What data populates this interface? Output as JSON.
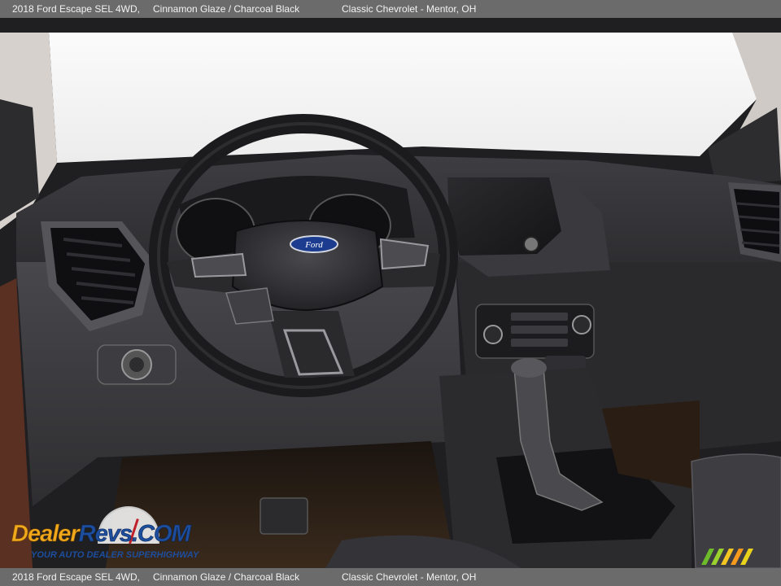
{
  "caption": {
    "vehicle": "2018 Ford Escape SEL 4WD,",
    "colors": "Cinnamon Glaze / Charcoal Black",
    "dealer": "Classic Chevrolet - Mentor, OH"
  },
  "photo": {
    "subject": "Dashboard and steering wheel interior photo",
    "badge": "Ford"
  },
  "watermark": {
    "logo_part1": "Dealer",
    "logo_part2": "Revs",
    "logo_part3": ".COM",
    "tagline": "YOUR AUTO DEALER SUPERHIGHWAY"
  },
  "colors": {
    "caption_bg": "#6b6b6b",
    "caption_text": "#f2f2f2",
    "dealerrevs_orange": "#f0a81c",
    "dealerrevs_blue": "#1d4e9e"
  }
}
